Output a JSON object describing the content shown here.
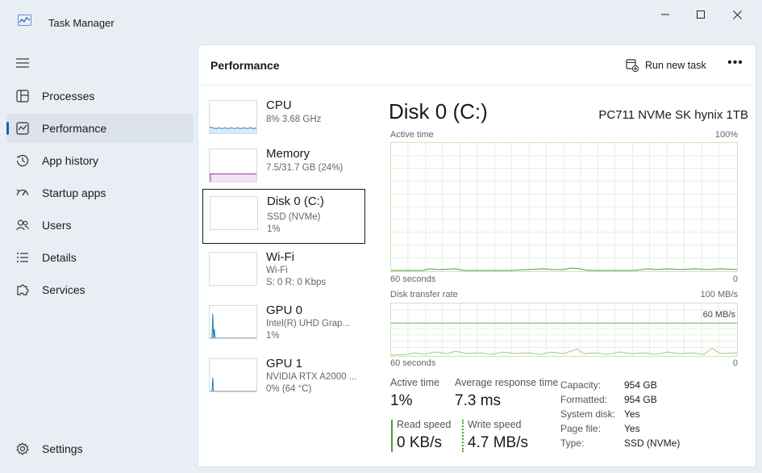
{
  "window": {
    "title": "Task Manager",
    "controls": {
      "minimize": "—",
      "maximize": "☐",
      "close": "✕"
    }
  },
  "sidebar": {
    "items": [
      {
        "label": "Processes"
      },
      {
        "label": "Performance"
      },
      {
        "label": "App history"
      },
      {
        "label": "Startup apps"
      },
      {
        "label": "Users"
      },
      {
        "label": "Details"
      },
      {
        "label": "Services"
      }
    ],
    "settings": "Settings",
    "active": "Performance"
  },
  "header": {
    "title": "Performance",
    "run_task": "Run new task",
    "more": "•••"
  },
  "devices": [
    {
      "name": "CPU",
      "sub1": "8% 3.68 GHz",
      "sub2": ""
    },
    {
      "name": "Memory",
      "sub1": "7.5/31.7 GB (24%)",
      "sub2": ""
    },
    {
      "name": "Disk 0 (C:)",
      "sub1": "SSD (NVMe)",
      "sub2": "1%"
    },
    {
      "name": "Wi-Fi",
      "sub1": "Wi-Fi",
      "sub2": "S: 0 R: 0 Kbps"
    },
    {
      "name": "GPU 0",
      "sub1": "Intel(R) UHD Grap...",
      "sub2": "1%"
    },
    {
      "name": "GPU 1",
      "sub1": "NVIDIA RTX A2000 ...",
      "sub2": "0% (64 °C)"
    }
  ],
  "detail": {
    "title": "Disk 0 (C:)",
    "model": "PC711 NVMe SK hynix 1TB",
    "graph1": {
      "label": "Active time",
      "max": "100%",
      "time": "60 seconds",
      "min": "0"
    },
    "graph2": {
      "label": "Disk transfer rate",
      "max": "100 MB/s",
      "inner": "60 MB/s",
      "time": "60 seconds",
      "min": "0"
    },
    "stats": {
      "active_time_label": "Active time",
      "active_time": "1%",
      "avg_response_label": "Average response time",
      "avg_response": "7.3 ms",
      "read_label": "Read speed",
      "read": "0 KB/s",
      "write_label": "Write speed",
      "write": "4.7 MB/s"
    },
    "props": [
      {
        "key": "Capacity:",
        "value": "954 GB"
      },
      {
        "key": "Formatted:",
        "value": "954 GB"
      },
      {
        "key": "System disk:",
        "value": "Yes"
      },
      {
        "key": "Page file:",
        "value": "Yes"
      },
      {
        "key": "Type:",
        "value": "SSD (NVMe)"
      }
    ]
  },
  "colors": {
    "accent": "#1a5fb4",
    "disk_green": "#4da02b",
    "cpu_blue": "#1f78b4",
    "memory_purple": "#8b3fa8",
    "grid": "#e5efe0"
  }
}
